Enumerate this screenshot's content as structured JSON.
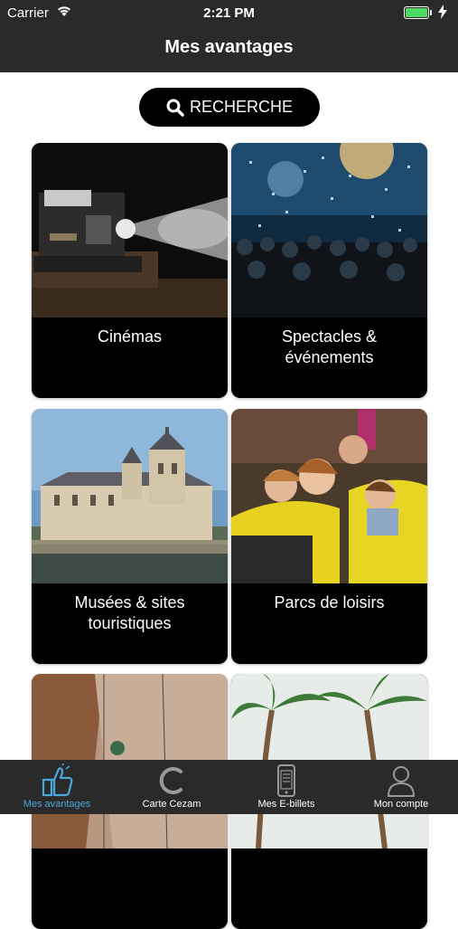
{
  "status_bar": {
    "carrier": "Carrier",
    "time": "2:21 PM"
  },
  "header": {
    "title": "Mes avantages"
  },
  "search": {
    "label": "RECHERCHE"
  },
  "categories": [
    {
      "label": "Cinémas"
    },
    {
      "label": "Spectacles & événements"
    },
    {
      "label": "Musées & sites touristiques"
    },
    {
      "label": "Parcs de loisirs"
    },
    {
      "label": ""
    },
    {
      "label": ""
    }
  ],
  "tabs": [
    {
      "label": "Mes avantages",
      "icon": "thumbs-up-icon",
      "active": true
    },
    {
      "label": "Carte Cezam",
      "icon": "cezam-c-icon",
      "active": false
    },
    {
      "label": "Mes E-billets",
      "icon": "phone-ticket-icon",
      "active": false
    },
    {
      "label": "Mon compte",
      "icon": "user-icon",
      "active": false
    }
  ],
  "colors": {
    "bar_bg": "#2a2a2a",
    "active_tab": "#4aa7d8",
    "battery": "#4cd964"
  }
}
